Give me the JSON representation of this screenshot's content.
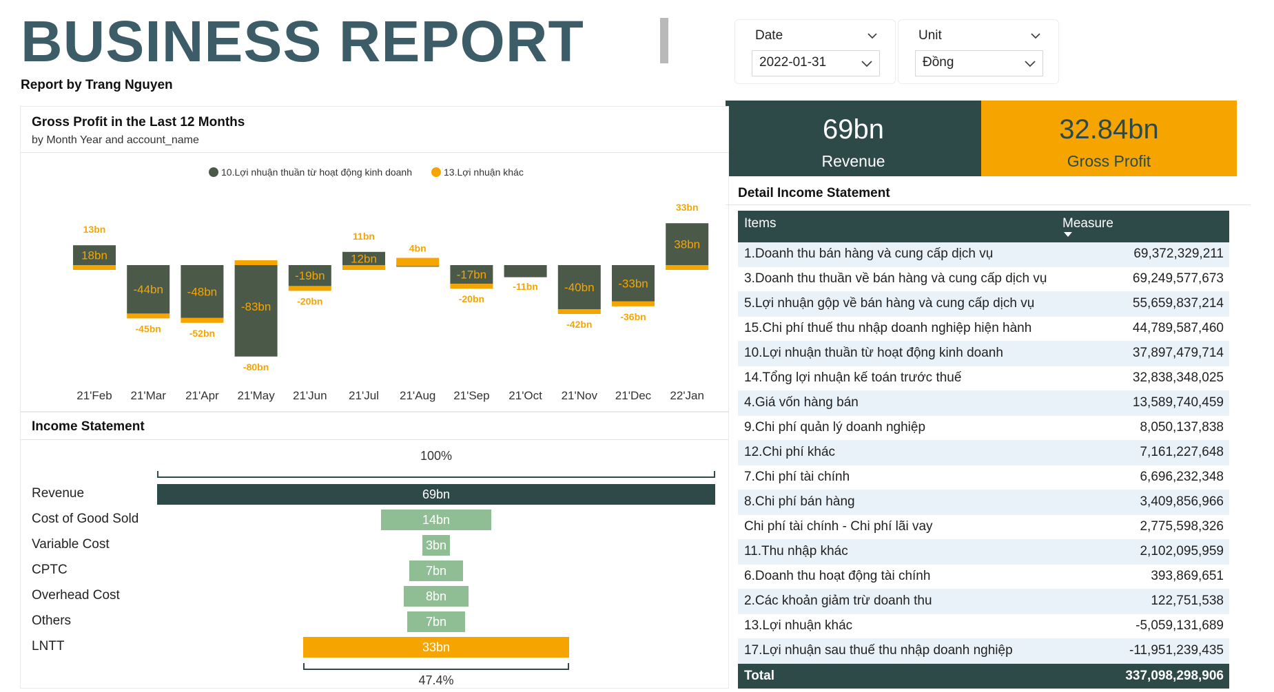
{
  "header": {
    "title": "BUSINESS REPORT",
    "subtitle": "Report by Trang Nguyen"
  },
  "slicers": {
    "date": {
      "label": "Date",
      "value": "2022-01-31"
    },
    "unit": {
      "label": "Unit",
      "value": "Đồng"
    }
  },
  "kpis": {
    "revenue": {
      "value": "69bn",
      "label": "Revenue"
    },
    "gross_profit": {
      "value": "32.84bn",
      "label": "Gross Profit"
    }
  },
  "gross_profit_chart": {
    "title": "Gross Profit in the Last 12 Months",
    "subtitle": "by Month Year and account_name"
  },
  "income_statement": {
    "title": "Income Statement",
    "top_pct": "100%",
    "bottom_pct": "47.4%",
    "rows": [
      {
        "label": "Revenue",
        "value": "69bn",
        "amount": 69,
        "color": "#2e4a48"
      },
      {
        "label": "Cost of Good Sold",
        "value": "14bn",
        "amount": 13.6,
        "color": "#8fbe94"
      },
      {
        "label": "Variable Cost",
        "value": "3bn",
        "amount": 3.4,
        "color": "#8fbe94"
      },
      {
        "label": "CPTC",
        "value": "7bn",
        "amount": 6.7,
        "color": "#8fbe94"
      },
      {
        "label": "Overhead Cost",
        "value": "8bn",
        "amount": 8.05,
        "color": "#8fbe94"
      },
      {
        "label": "Others",
        "value": "7bn",
        "amount": 7.16,
        "color": "#8fbe94"
      },
      {
        "label": "LNTT",
        "value": "33bn",
        "amount": 32.84,
        "color": "#f6a500"
      }
    ]
  },
  "detail": {
    "title": "Detail Income Statement",
    "col_items": "Items",
    "col_measure": "Measure",
    "rows": [
      {
        "item": "1.Doanh thu bán hàng và cung cấp dịch vụ",
        "measure": "69,372,329,211"
      },
      {
        "item": "3.Doanh thu thuần về bán hàng và cung cấp dịch vụ",
        "measure": "69,249,577,673"
      },
      {
        "item": "5.Lợi nhuận gộp về bán hàng và cung cấp dịch vụ",
        "measure": "55,659,837,214"
      },
      {
        "item": "15.Chi phí thuế thu nhập doanh nghiệp hiện hành",
        "measure": "44,789,587,460"
      },
      {
        "item": "10.Lợi nhuận thuần từ hoạt động kinh doanh",
        "measure": "37,897,479,714"
      },
      {
        "item": "14.Tổng lợi nhuận kế toán trước thuế",
        "measure": "32,838,348,025"
      },
      {
        "item": "4.Giá vốn hàng bán",
        "measure": "13,589,740,459"
      },
      {
        "item": "9.Chi phí quản lý doanh nghiệp",
        "measure": "8,050,137,838"
      },
      {
        "item": "12.Chi phí khác",
        "measure": "7,161,227,648"
      },
      {
        "item": "7.Chi phí tài chính",
        "measure": "6,696,232,348"
      },
      {
        "item": "8.Chi phí bán hàng",
        "measure": "3,409,856,966"
      },
      {
        "item": "Chi phí tài chính - Chi phí lãi vay",
        "measure": "2,775,598,326"
      },
      {
        "item": "11.Thu nhập khác",
        "measure": "2,102,095,959"
      },
      {
        "item": "6.Doanh thu hoạt động tài chính",
        "measure": "393,869,651"
      },
      {
        "item": "2.Các khoản giảm trừ doanh thu",
        "measure": "122,751,538"
      },
      {
        "item": "13.Lợi nhuận khác",
        "measure": "-5,059,131,689"
      },
      {
        "item": "17.Lợi nhuận sau thuế thu nhập doanh nghiệp",
        "measure": "-11,951,239,435"
      }
    ],
    "total_label": "Total",
    "total_value": "337,098,298,906"
  },
  "colors": {
    "dark": "#2e4a48",
    "orange": "#f6a500",
    "green": "#8fbe94",
    "title_blue": "#3c5c68"
  },
  "chart_data": {
    "type": "bar",
    "title": "Gross Profit in the Last 12 Months",
    "subtitle": "by Month Year and account_name",
    "categories": [
      "21'Feb",
      "21'Mar",
      "21'Apr",
      "21'May",
      "21'Jun",
      "21'Jul",
      "21'Aug",
      "21'Sep",
      "21'Oct",
      "21'Nov",
      "21'Dec",
      "22'Jan"
    ],
    "legend_position": "top-center",
    "series": [
      {
        "name": "10.Lợi nhuận thuần từ hoạt động kinh doanh",
        "color": "#4b5a48",
        "values": [
          18,
          -44,
          -48,
          -83,
          -19,
          12,
          1,
          -17,
          -11,
          -40,
          -33,
          38
        ],
        "labels": [
          "18bn",
          "-44bn",
          "-48bn",
          "-83bn",
          "-19bn",
          "12bn",
          "",
          "-17bn",
          "-11bn",
          "-40bn",
          "-33bn",
          "38bn"
        ]
      },
      {
        "name": "13.Lợi nhuận khác",
        "color": "#f6a500",
        "values": [
          13,
          -45,
          -52,
          -80,
          -20,
          11,
          4,
          -20,
          -11,
          -42,
          -36,
          33
        ],
        "labels": [
          "13bn",
          "-45bn",
          "-52bn",
          "-80bn",
          "-20bn",
          "11bn",
          "4bn",
          "-20bn",
          "-11bn",
          "-42bn",
          "-36bn",
          "33bn"
        ]
      }
    ]
  }
}
